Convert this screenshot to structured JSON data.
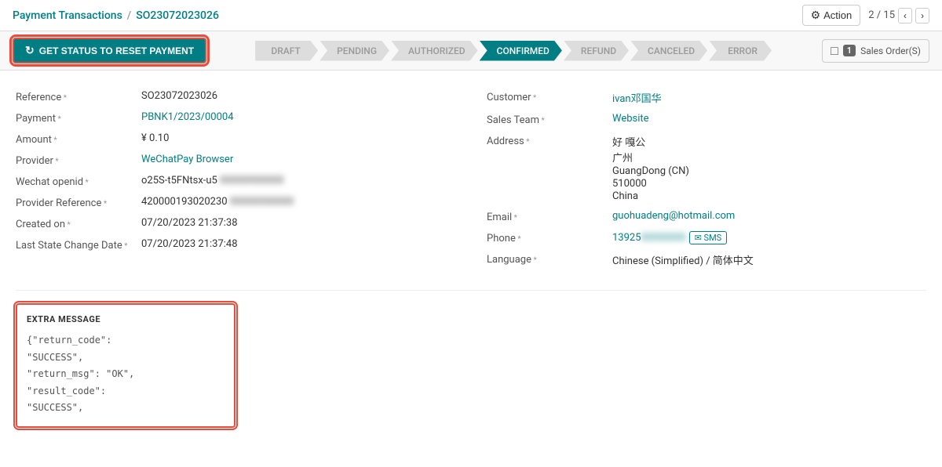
{
  "header": {
    "breadcrumb_parent": "Payment Transactions",
    "breadcrumb_separator": "/",
    "breadcrumb_current": "SO23072023026",
    "action_label": "Action",
    "nav_position": "2 / 15"
  },
  "reset_btn": {
    "label": "GET STATUS TO RESET PAYMENT",
    "refresh_icon": "↻"
  },
  "pipeline": {
    "steps": [
      {
        "label": "DRAFT",
        "state": "inactive"
      },
      {
        "label": "PENDING",
        "state": "inactive"
      },
      {
        "label": "AUTHORIZED",
        "state": "inactive"
      },
      {
        "label": "CONFIRMED",
        "state": "active"
      },
      {
        "label": "REFUND",
        "state": "inactive"
      },
      {
        "label": "CANCELED",
        "state": "inactive"
      },
      {
        "label": "ERROR",
        "state": "inactive"
      }
    ]
  },
  "sales_order_badge": {
    "count": "1",
    "label": "Sales Order(S)"
  },
  "form": {
    "left": [
      {
        "label": "Reference",
        "value": "SO23072023026",
        "type": "text"
      },
      {
        "label": "Payment",
        "value": "PBNK1/2023/00004",
        "type": "link"
      },
      {
        "label": "Amount",
        "value": "¥ 0.10",
        "type": "text"
      },
      {
        "label": "Provider",
        "value": "WeChatPay Browser",
        "type": "link"
      },
      {
        "label": "Wechat openid",
        "value": "o25S-t5FNtsx-u5",
        "value_blurred": "XXXXXXXXXX",
        "type": "blurred"
      },
      {
        "label": "Provider Reference",
        "value": "420000193020230",
        "value_blurred": "XXXXXXXXXX",
        "type": "blurred"
      },
      {
        "label": "Created on",
        "value": "07/20/2023 21:37:38",
        "type": "text"
      },
      {
        "label": "Last State Change Date",
        "value": "07/20/2023 21:37:48",
        "type": "text"
      }
    ],
    "right": [
      {
        "label": "Customer",
        "value": "ivan邓国华",
        "type": "link"
      },
      {
        "label": "Sales Team",
        "value": "Website",
        "type": "link"
      },
      {
        "label": "Address",
        "address_lines": [
          "好 嘎公",
          "广州",
          "GuangDong (CN)",
          "510000",
          "China"
        ],
        "type": "address"
      },
      {
        "label": "Email",
        "value": "guohuadeng@hotmail.com",
        "type": "link"
      },
      {
        "label": "Phone",
        "value": "13925",
        "value_blurred": "XXXXXXX",
        "sms_label": "SMS",
        "type": "phone"
      },
      {
        "label": "Language",
        "value": "Chinese (Simplified) / 简体中文",
        "type": "text"
      }
    ]
  },
  "extra_message": {
    "title": "EXTRA MESSAGE",
    "content_lines": [
      "{\"return_code\":",
      "\"SUCCESS\",",
      "\"return_msg\": \"OK\",",
      "\"result_code\":",
      "\"SUCCESS\","
    ]
  }
}
